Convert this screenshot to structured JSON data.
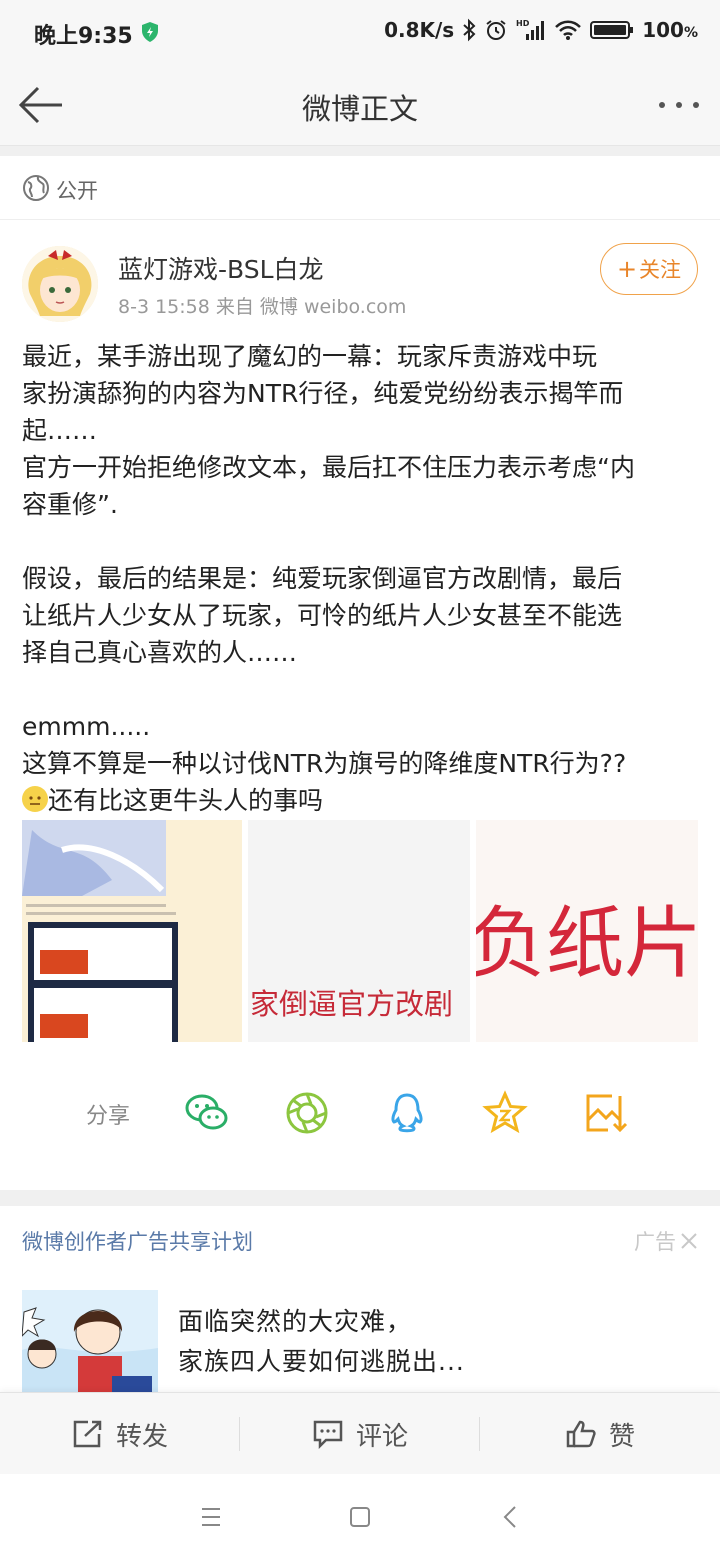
{
  "status": {
    "time": "晚上9:35",
    "net_speed": "0.8K/s",
    "battery": "100",
    "battery_unit": "%"
  },
  "nav": {
    "title": "微博正文"
  },
  "visibility": {
    "label": "公开"
  },
  "author": {
    "name": "蓝灯游戏-BSL白龙",
    "meta": "8-3 15:58  来自 微博 weibo.com",
    "follow_label": "关注"
  },
  "post": {
    "lines": [
      "最近，某手游出现了魔幻的一幕：玩家斥责游戏中玩",
      "家扮演舔狗的内容为NTR行径，纯爱党纷纷表示揭竿而",
      "起……",
      "官方一开始拒绝修改文本，最后扛不住压力表示考虑“内",
      "容重修”.",
      "",
      "假设，最后的结果是：纯爱玩家倒逼官方改剧情，最后",
      "让纸片人少女从了玩家，可怜的纸片人少女甚至不能选",
      "择自己真心喜欢的人……",
      "",
      "emmm.....",
      "这算不算是一种以讨伐NTR为旗号的降维度NTR行为??"
    ],
    "last_line": "还有比这更牛头人的事吗",
    "image2_text": "家倒逼官方改剧",
    "image3_text": "负纸片"
  },
  "share": {
    "label": "分享"
  },
  "ad": {
    "header": "微博创作者广告共享计划",
    "tag": "广告",
    "line1": "面临突然的大灾难，",
    "line2": "家族四人要如何逃脱出..."
  },
  "actions": {
    "repost": "转发",
    "comment": "评论",
    "like": "赞"
  },
  "colors": {
    "accent": "#e8852a",
    "link": "#5a7aa8",
    "wechat": "#2aae67",
    "qq": "#3aa5e8",
    "favorite": "#f3b51c"
  }
}
